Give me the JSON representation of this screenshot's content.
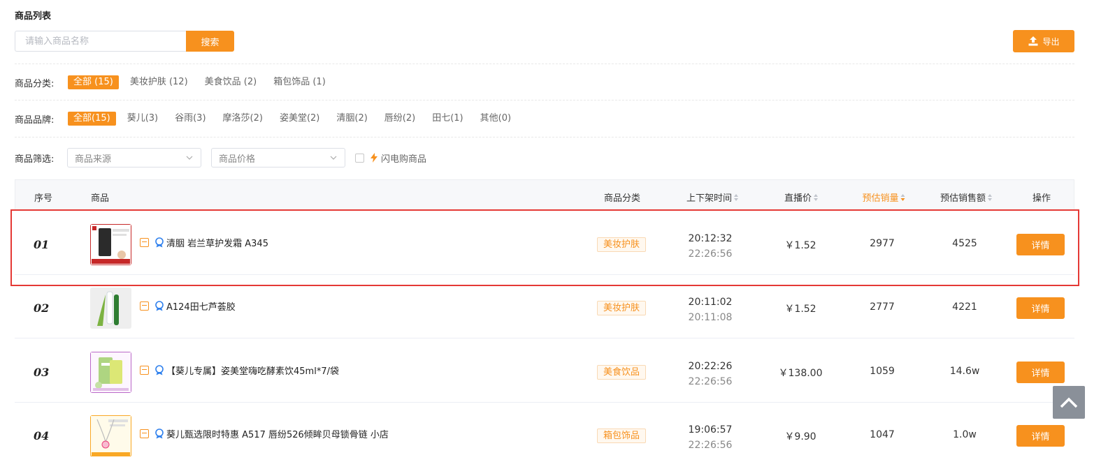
{
  "page": {
    "title": "商品列表"
  },
  "search": {
    "placeholder": "请输入商品名称",
    "value": "",
    "button_label": "搜索"
  },
  "export": {
    "label": "导出"
  },
  "category_filter": {
    "label": "商品分类:",
    "options": [
      "全部 (15)",
      "美妆护肤 (12)",
      "美食饮品 (2)",
      "箱包饰品 (1)"
    ],
    "selected": 0
  },
  "brand_filter": {
    "label": "商品品牌:",
    "options": [
      "全部(15)",
      "葵儿(3)",
      "谷雨(3)",
      "摩洛莎(2)",
      "姿美堂(2)",
      "清胭(2)",
      "唇纷(2)",
      "田七(1)",
      "其他(0)"
    ],
    "selected": 0
  },
  "screen_filter": {
    "label": "商品筛选:",
    "source_placeholder": "商品来源",
    "price_placeholder": "商品价格",
    "flash_label": "闪电购商品",
    "flash_checked": false
  },
  "table": {
    "headers": {
      "index": "序号",
      "product": "商品",
      "category": "商品分类",
      "shelf_time": "上下架时间",
      "live_price": "直播价",
      "est_sales": "预估销量",
      "est_revenue": "预估销售额",
      "action": "操作"
    },
    "active_sort": "est_sales",
    "detail_label": "详情",
    "rows": [
      {
        "index": "01",
        "name": "清胭 岩兰草护发霜 A345",
        "category": "美妆护肤",
        "on_time": "20:12:32",
        "off_time": "22:26:56",
        "price": "￥1.52",
        "sales": "2977",
        "revenue": "4525"
      },
      {
        "index": "02",
        "name": "A124田七芦荟胶",
        "category": "美妆护肤",
        "on_time": "20:11:02",
        "off_time": "20:11:08",
        "price": "￥1.52",
        "sales": "2777",
        "revenue": "4221"
      },
      {
        "index": "03",
        "name": "【葵儿专属】姿美堂嗨吃酵素饮45ml*7/袋",
        "category": "美食饮品",
        "on_time": "20:22:26",
        "off_time": "22:26:56",
        "price": "￥138.00",
        "sales": "1059",
        "revenue": "14.6w"
      },
      {
        "index": "04",
        "name": "葵儿甄选限时特惠 A517 唇纷526倾眸贝母锁骨链 小店",
        "category": "箱包饰品",
        "on_time": "19:06:57",
        "off_time": "22:26:56",
        "price": "￥9.90",
        "sales": "1047",
        "revenue": "1.0w"
      }
    ]
  },
  "colors": {
    "accent": "#f7911e",
    "highlight": "#e53935"
  }
}
